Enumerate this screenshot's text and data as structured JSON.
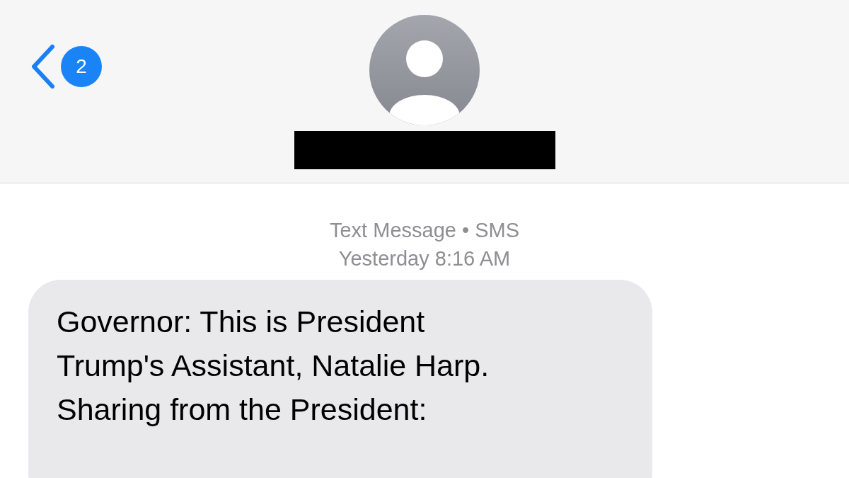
{
  "header": {
    "unread_count": "2",
    "name_redacted": true
  },
  "thread": {
    "service": "Text Message • SMS",
    "timestamp": "Yesterday 8:16 AM",
    "messages": [
      {
        "kind": "received",
        "lines": [
          "Governor: This is President",
          "Trump's Assistant, Natalie Harp.",
          "Sharing from the President:"
        ]
      }
    ]
  }
}
